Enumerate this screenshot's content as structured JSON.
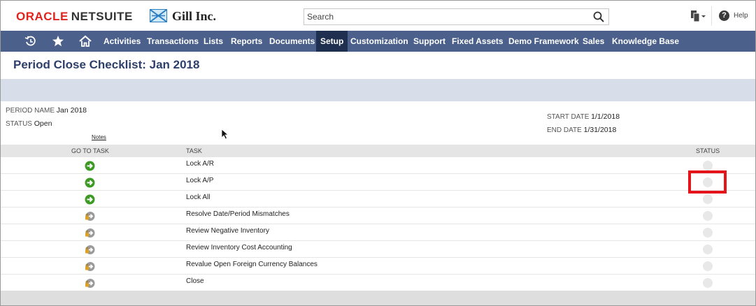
{
  "header": {
    "logo_oracle": "ORACLE",
    "logo_netsuite": "NETSUITE",
    "company_name": "Gill Inc.",
    "search_placeholder": "Search",
    "help_label": "Help"
  },
  "nav": {
    "items": [
      {
        "label": "Activities"
      },
      {
        "label": "Transactions"
      },
      {
        "label": "Lists"
      },
      {
        "label": "Reports"
      },
      {
        "label": "Documents"
      },
      {
        "label": "Setup",
        "active": true
      },
      {
        "label": "Customization"
      },
      {
        "label": "Support"
      },
      {
        "label": "Fixed Assets"
      },
      {
        "label": "Demo Framework"
      },
      {
        "label": "Sales"
      },
      {
        "label": "Knowledge Base"
      }
    ]
  },
  "page": {
    "title": "Period Close Checklist: Jan 2018",
    "fields": {
      "period_name_label": "Period Name",
      "period_name_value": "Jan 2018",
      "status_label": "Status",
      "status_value": "Open",
      "start_date_label": "Start Date",
      "start_date_value": "1/1/2018",
      "end_date_label": "End Date",
      "end_date_value": "1/31/2018",
      "notes_link": "Notes"
    }
  },
  "table": {
    "headers": {
      "go_to_task": "Go To Task",
      "task": "Task",
      "status": "Status"
    },
    "rows": [
      {
        "task": "Lock A/R",
        "icon": "green-arrow-icon"
      },
      {
        "task": "Lock A/P",
        "icon": "green-arrow-icon"
      },
      {
        "task": "Lock All",
        "icon": "green-arrow-icon"
      },
      {
        "task": "Resolve Date/Period Mismatches",
        "icon": "locked-arrow-icon"
      },
      {
        "task": "Review Negative Inventory",
        "icon": "locked-arrow-icon"
      },
      {
        "task": "Review Inventory Cost Accounting",
        "icon": "locked-arrow-icon"
      },
      {
        "task": "Revalue Open Foreign Currency Balances",
        "icon": "locked-arrow-icon"
      },
      {
        "task": "Close",
        "icon": "locked-arrow-icon"
      }
    ]
  },
  "colors": {
    "nav_bg": "#4b608b",
    "nav_active": "#1f2f4f",
    "title": "#2d3f6a",
    "highlight": "#e5141b"
  }
}
